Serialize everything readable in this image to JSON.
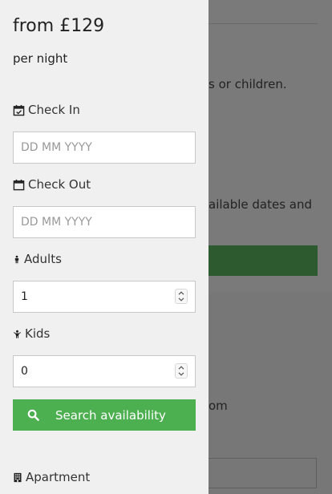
{
  "background": {
    "text_lines": [
      "s or children.",
      "ailable dates and",
      "om"
    ]
  },
  "drawer": {
    "price": "from £129",
    "per_night": "per night",
    "check_in": {
      "label": "Check In",
      "placeholder": "DD MM YYYY",
      "value": ""
    },
    "check_out": {
      "label": "Check Out",
      "placeholder": "DD MM YYYY",
      "value": ""
    },
    "adults": {
      "label": "Adults",
      "value": "1"
    },
    "kids": {
      "label": "Kids",
      "value": "0"
    },
    "search_label": "Search availability",
    "property_type": "Apartment"
  },
  "colors": {
    "accent": "#4caf50",
    "drawer_bg": "#f0f0f0",
    "overlay": "#7a7a7a"
  }
}
